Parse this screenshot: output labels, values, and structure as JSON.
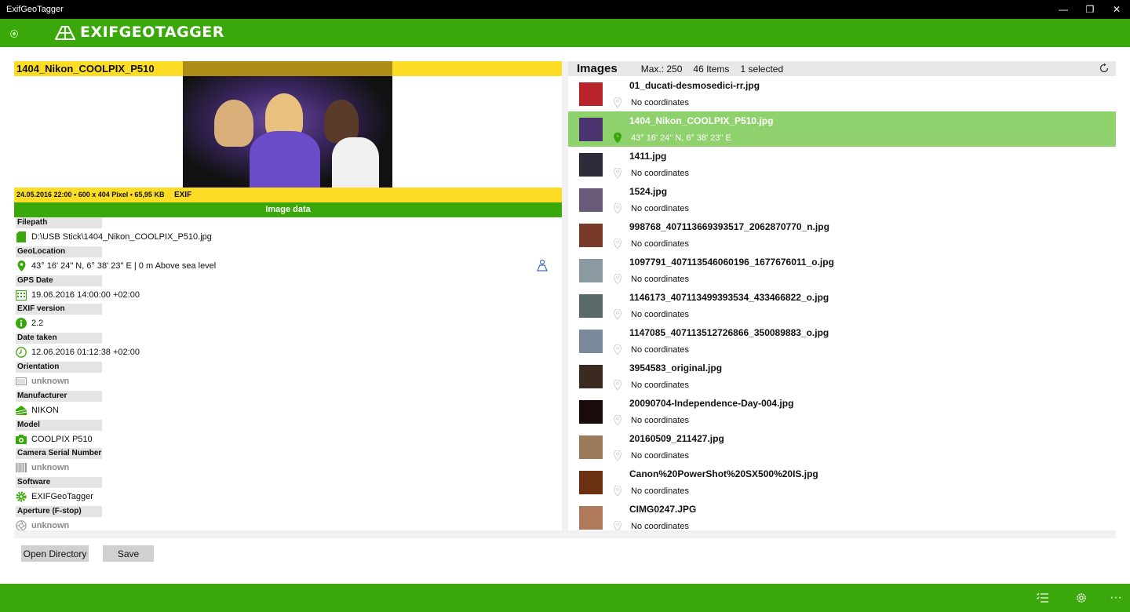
{
  "window": {
    "title": "ExifGeoTagger",
    "controls": [
      "—",
      "❐",
      "✕"
    ]
  },
  "header": {
    "logo_text": "EXIFGEOTAGGER"
  },
  "image_panel": {
    "title": "1404_Nikon_COOLPIX_P510",
    "meta": "24.05.2016 22:00 • 600 x 404 Pixel • 65,95 KB",
    "exif_badge": "EXIF",
    "section_title": "Image data",
    "fields": [
      {
        "label": "Filepath",
        "value": "D:\\USB Stick\\1404_Nikon_COOLPIX_P510.jpg",
        "icon": "sd-card-icon",
        "dim": false
      },
      {
        "label": "GeoLocation",
        "value": "43° 16' 24\" N, 6° 38' 23\" E | 0 m Above sea level",
        "icon": "location-pin-icon",
        "dim": false
      },
      {
        "label": "GPS Date",
        "value": "19.06.2016 14:00:00 +02:00",
        "icon": "calendar-icon",
        "dim": false
      },
      {
        "label": "EXIF version",
        "value": "2.2",
        "icon": "info-icon",
        "dim": false
      },
      {
        "label": "Date taken",
        "value": "12.06.2016 01:12:38 +02:00",
        "icon": "clock-icon",
        "dim": false
      },
      {
        "label": "Orientation",
        "value": "unknown",
        "icon": "orientation-icon",
        "dim": true
      },
      {
        "label": "Manufacturer",
        "value": "NIKON",
        "icon": "manufacturer-icon",
        "dim": false
      },
      {
        "label": "Model",
        "value": "COOLPIX P510",
        "icon": "camera-icon",
        "dim": false
      },
      {
        "label": "Camera Serial Number",
        "value": "unknown",
        "icon": "barcode-icon",
        "dim": true
      },
      {
        "label": "Software",
        "value": "EXIFGeoTagger",
        "icon": "gear-icon",
        "dim": false
      },
      {
        "label": "Aperture (F-stop)",
        "value": "unknown",
        "icon": "aperture-icon",
        "dim": true
      }
    ]
  },
  "images_panel": {
    "title": "Images",
    "max": "Max.: 250",
    "count": "46 Items",
    "selected": "1 selected",
    "items": [
      {
        "name": "01_ducati-desmosedici-rr.jpg",
        "coords": "No coordinates",
        "selected": false,
        "thumb_color": "#b8242a"
      },
      {
        "name": "1404_Nikon_COOLPIX_P510.jpg",
        "coords": "43° 16' 24\" N, 6° 38' 23\" E",
        "selected": true,
        "thumb_color": "#4b3470"
      },
      {
        "name": "1411.jpg",
        "coords": "No coordinates",
        "selected": false,
        "thumb_color": "#2c2c3a"
      },
      {
        "name": "1524.jpg",
        "coords": "No coordinates",
        "selected": false,
        "thumb_color": "#6a5a7a"
      },
      {
        "name": "998768_407113669393517_2062870770_n.jpg",
        "coords": "No coordinates",
        "selected": false,
        "thumb_color": "#7a3a2a"
      },
      {
        "name": "1097791_407113546060196_1677676011_o.jpg",
        "coords": "No coordinates",
        "selected": false,
        "thumb_color": "#8a9aa0"
      },
      {
        "name": "1146173_407113499393534_433466822_o.jpg",
        "coords": "No coordinates",
        "selected": false,
        "thumb_color": "#5a6a6a"
      },
      {
        "name": "1147085_407113512726866_350089883_o.jpg",
        "coords": "No coordinates",
        "selected": false,
        "thumb_color": "#7a8a9a"
      },
      {
        "name": "3954583_original.jpg",
        "coords": "No coordinates",
        "selected": false,
        "thumb_color": "#3a2a20"
      },
      {
        "name": "20090704-Independence-Day-004.jpg",
        "coords": "No coordinates",
        "selected": false,
        "thumb_color": "#1a0a0a"
      },
      {
        "name": "20160509_211427.jpg",
        "coords": "No coordinates",
        "selected": false,
        "thumb_color": "#9a7a5a"
      },
      {
        "name": "Canon%20PowerShot%20SX500%20IS.jpg",
        "coords": "No coordinates",
        "selected": false,
        "thumb_color": "#6a3010"
      },
      {
        "name": "CIMG0247.JPG",
        "coords": "No coordinates",
        "selected": false,
        "thumb_color": "#b07a5a"
      }
    ]
  },
  "buttons": {
    "open_directory": "Open Directory",
    "save": "Save"
  },
  "bottom_bar": {
    "icons": [
      "list-icon",
      "gear-icon",
      "more-icon"
    ],
    "more": "···"
  },
  "colors": {
    "brand_green": "#3aa80a",
    "selection_green": "#8fd16c",
    "title_yellow": "#fcdc25"
  }
}
